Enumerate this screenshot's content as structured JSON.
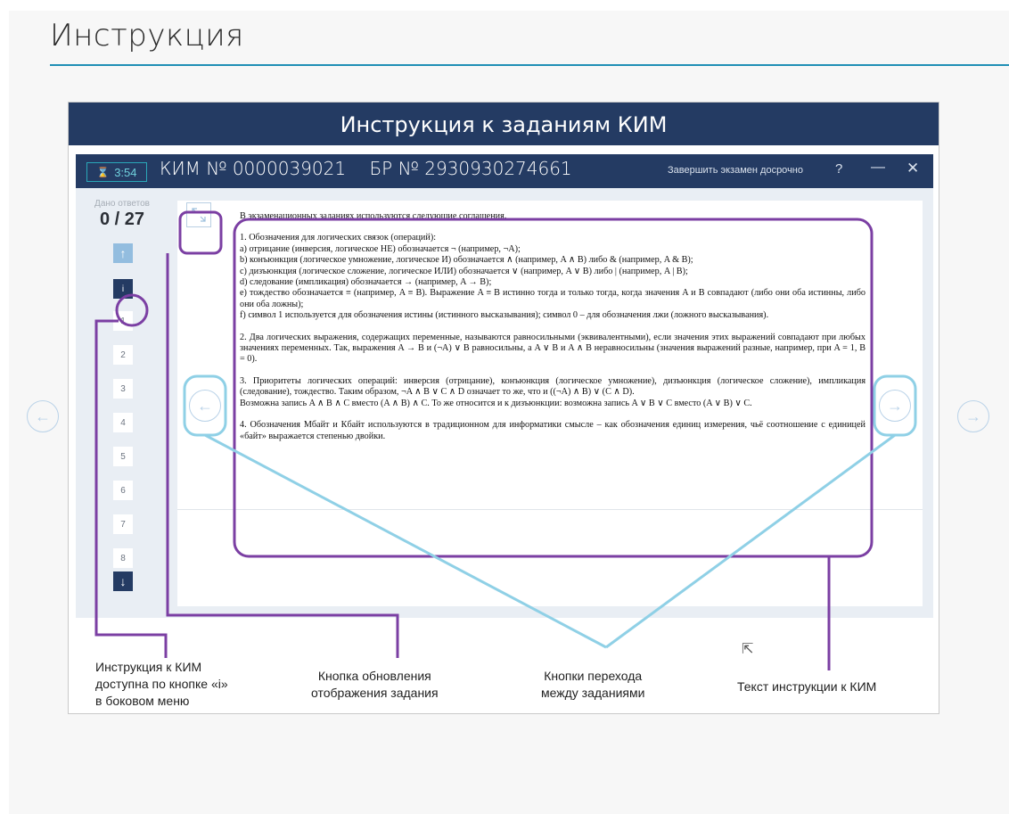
{
  "slide": {
    "title": "Инструкция"
  },
  "panel": {
    "banner": "Инструкция к заданиям КИМ"
  },
  "exam_window": {
    "timer": "3:54",
    "timer_icon": "hourglass-icon",
    "kim_label": "КИМ № 0000039021",
    "br_label": "БР № 2930930274661",
    "finish_label": "Завершить экзамен досрочно",
    "help_label": "?",
    "minimize_label": "—",
    "close_label": "✕"
  },
  "sidebar": {
    "answered_label": "Дано ответов",
    "answered_count": "0 / 27",
    "info_label": "i",
    "questions": [
      "1",
      "2",
      "3",
      "4",
      "5",
      "6",
      "7",
      "8"
    ]
  },
  "instruction_text": {
    "intro": "В экзаменационных заданиях используются следующие соглашения.",
    "p1": "1. Обозначения для логических связок (операций):",
    "p1_a": "a) отрицание (инверсия, логическое НЕ) обозначается ¬ (например, ¬A);",
    "p1_b": "b) конъюнкция (логическое умножение, логическое И) обозначается ∧ (например, A ∧ B) либо & (например, A & B);",
    "p1_c": "c) дизъюнкция (логическое сложение, логическое ИЛИ) обозначается ∨ (например, A ∨ B) либо | (например, A | B);",
    "p1_d": "d) следование (импликация) обозначается → (например, A → B);",
    "p1_e": "e) тождество обозначается ≡ (например, A ≡ B). Выражение A ≡ B истинно тогда и только тогда, когда значения A и B совпадают (либо они оба истинны, либо они оба ложны);",
    "p1_f": "f) символ 1 используется для обозначения истины (истинного высказывания); символ 0 – для обозначения лжи (ложного высказывания).",
    "p2": "2. Два логических выражения, содержащих переменные, называются равносильными (эквивалентными), если значения этих выражений совпадают при любых значениях переменных. Так, выражения A → B и (¬A) ∨ B равносильны, а A ∨ B и A ∧ B неравносильны (значения выражений разные, например, при A = 1, B = 0).",
    "p3": "3. Приоритеты логических операций: инверсия (отрицание), конъюнкция (логическое умножение), дизъюнкция (логическое сложение), импликация (следование), тождество. Таким образом, ¬A ∧ B ∨ C ∧ D означает то же, что и ((¬A) ∧ B) ∨ (C ∧ D).",
    "p3_b": "Возможна запись A ∧ B ∧ C вместо (A ∧ B) ∧ C. То же относится и к дизъюнкции: возможна запись A ∨ B ∨ C вместо (A ∨ B) ∨ C.",
    "p4": "4. Обозначения Мбайт и Кбайт используются в традиционном для информатики смысле – как обозначения единиц измерения, чьё соотношение с единицей «байт» выражается степенью двойки."
  },
  "annotations": {
    "info_note_1": "Инструкция к КИМ",
    "info_note_2": "доступна по кнопке «i»",
    "info_note_3": "в боковом меню",
    "refresh_note_1": "Кнопка обновления",
    "refresh_note_2": "отображения задания",
    "nav_note_1": "Кнопки перехода",
    "nav_note_2": "между заданиями",
    "text_note": "Текст инструкции к КИМ"
  },
  "icons": {
    "prev": "arrow-left-circle-icon",
    "next": "arrow-right-circle-icon",
    "up": "arrow-up-icon",
    "down": "arrow-down-icon",
    "refresh": "expand-refresh-icon"
  },
  "colors": {
    "banner": "#243b63",
    "highlight": "#7b3fa3",
    "nav_highlight": "#8fd0e6",
    "rule": "#1f8fb5"
  }
}
